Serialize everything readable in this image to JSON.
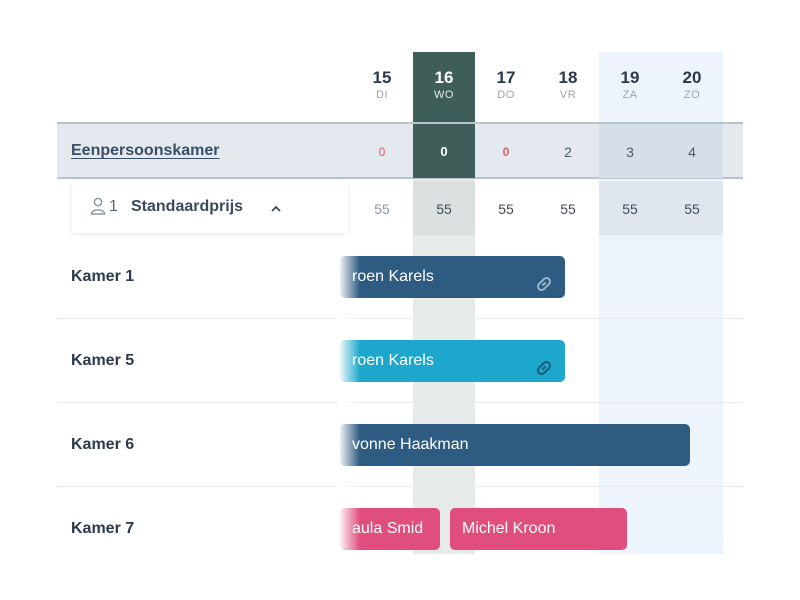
{
  "calendar": {
    "days": [
      {
        "num": "15",
        "wd": "DI"
      },
      {
        "num": "16",
        "wd": "WO"
      },
      {
        "num": "17",
        "wd": "DO"
      },
      {
        "num": "18",
        "wd": "VR"
      },
      {
        "num": "19",
        "wd": "ZA"
      },
      {
        "num": "20",
        "wd": "ZO"
      }
    ]
  },
  "room_type": {
    "name": "Eenpersoonskamer",
    "availability": [
      "0",
      "0",
      "0",
      "2",
      "3",
      "4"
    ]
  },
  "rate": {
    "guests": "1",
    "name": "Standaardprijs",
    "prices": [
      "55",
      "55",
      "55",
      "55",
      "55",
      "55"
    ]
  },
  "rooms": [
    {
      "label": "Kamer 1"
    },
    {
      "label": "Kamer 5"
    },
    {
      "label": "Kamer 6"
    },
    {
      "label": "Kamer 7"
    }
  ],
  "bookings": [
    {
      "guest": "roen Karels",
      "room": "Kamer 1",
      "linked": true
    },
    {
      "guest": "roen Karels",
      "room": "Kamer 5",
      "linked": true
    },
    {
      "guest": "vonne Haakman",
      "room": "Kamer 6",
      "linked": false
    },
    {
      "guest": "aula Smid",
      "room": "Kamer 7",
      "linked": false
    },
    {
      "guest": "Michel Kroon",
      "room": "Kamer 7",
      "linked": false
    }
  ],
  "colors": {
    "booking_dark": "#2d5b82",
    "booking_cyan": "#1ea7cd",
    "booking_pink": "#e04e7e",
    "today_header": "#3f5d59",
    "zero_availability": "#e45a6e"
  }
}
